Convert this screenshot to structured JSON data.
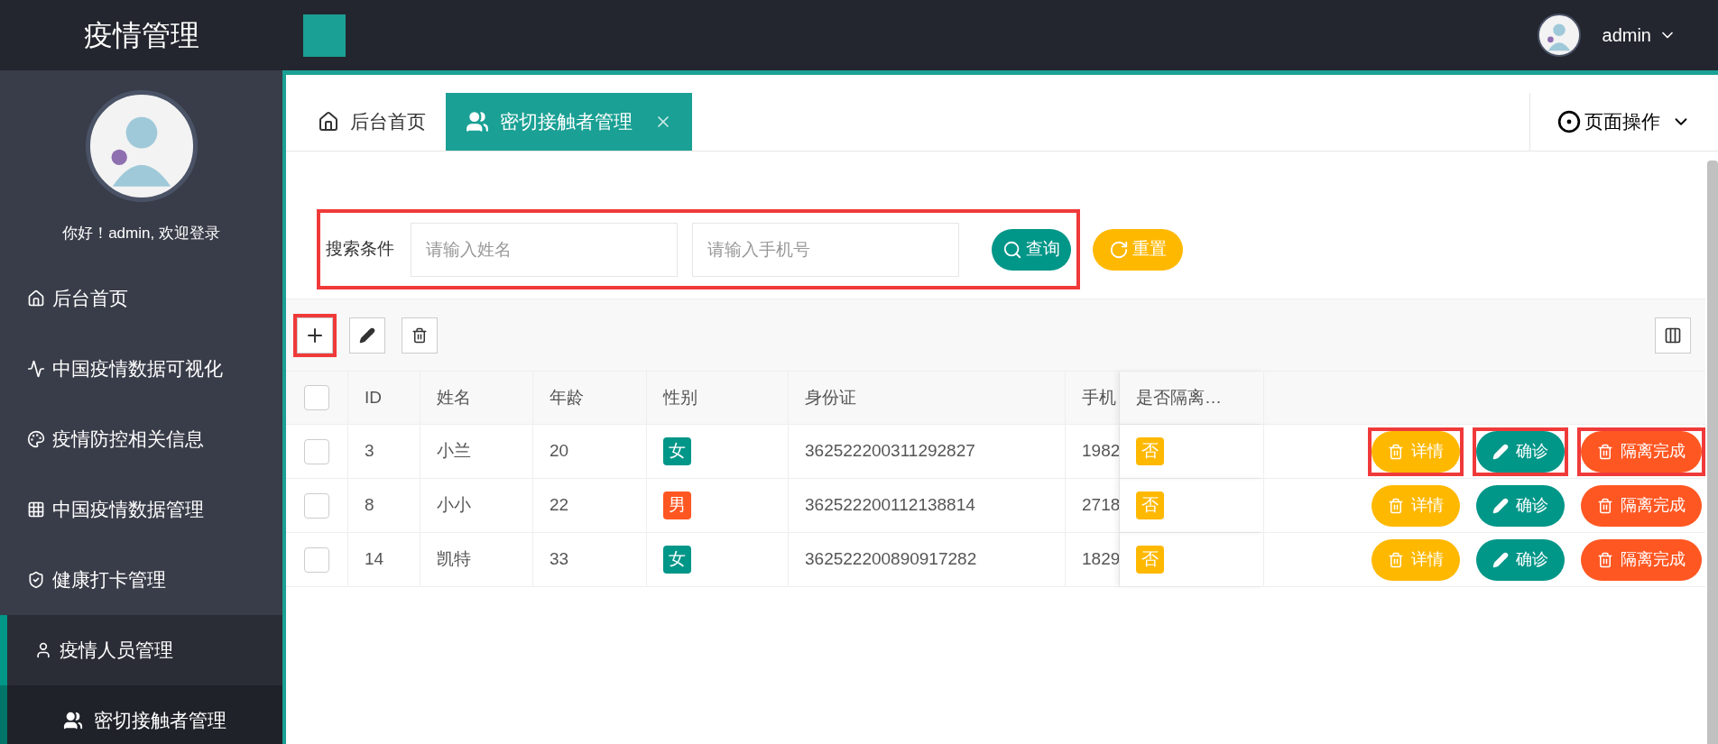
{
  "header": {
    "title": "疫情管理",
    "user": "admin"
  },
  "sidebar": {
    "greeting": "你好！admin, 欢迎登录",
    "items": [
      {
        "label": "后台首页",
        "selected": false
      },
      {
        "label": "中国疫情数据可视化",
        "selected": false
      },
      {
        "label": "疫情防控相关信息",
        "selected": false
      },
      {
        "label": "中国疫情数据管理",
        "selected": false
      },
      {
        "label": "健康打卡管理",
        "selected": false
      },
      {
        "label": "疫情人员管理",
        "selected": true,
        "children": [
          {
            "label": "密切接触者管理",
            "selected": true
          }
        ]
      }
    ]
  },
  "tabs": [
    {
      "label": "后台首页",
      "selected": false,
      "closable": false
    },
    {
      "label": "密切接触者管理",
      "selected": true,
      "closable": true
    }
  ],
  "page_actions": "页面操作",
  "search": {
    "label": "搜索条件",
    "highlighted": true,
    "fields": [
      {
        "placeholder": "请输入姓名"
      },
      {
        "placeholder": "请输入手机号"
      }
    ],
    "buttons": [
      {
        "label": "查询",
        "kind": "query"
      },
      {
        "label": "重置",
        "kind": "reset"
      }
    ]
  },
  "toolbar": [
    {
      "kind": "add",
      "highlighted": true
    },
    {
      "kind": "edit",
      "highlighted": false
    },
    {
      "kind": "delete",
      "highlighted": false
    }
  ],
  "table": {
    "all_checked": false,
    "columns": [
      "ID",
      "姓名",
      "年龄",
      "性别",
      "身份证",
      "手机",
      "是否隔离…"
    ],
    "rows": [
      {
        "checked": false,
        "id": "3",
        "name": "小兰",
        "age": "20",
        "sex": {
          "label": "女",
          "color": "#009688"
        },
        "idcard": "362522200311292827",
        "phone": "1982",
        "isolated": {
          "label": "否",
          "color": "#ffb800"
        },
        "actions": [
          {
            "label": "详情",
            "kind": "detail",
            "highlighted": true
          },
          {
            "label": "确诊",
            "kind": "confirm",
            "highlighted": true
          },
          {
            "label": "隔离完成",
            "kind": "finish",
            "highlighted": true
          }
        ]
      },
      {
        "checked": false,
        "id": "8",
        "name": "小小",
        "age": "22",
        "sex": {
          "label": "男",
          "color": "#ff5722"
        },
        "idcard": "362522200112138814",
        "phone": "2718",
        "isolated": {
          "label": "否",
          "color": "#ffb800"
        },
        "actions": [
          {
            "label": "详情",
            "kind": "detail",
            "highlighted": false
          },
          {
            "label": "确诊",
            "kind": "confirm",
            "highlighted": false
          },
          {
            "label": "隔离完成",
            "kind": "finish",
            "highlighted": false
          }
        ]
      },
      {
        "checked": false,
        "id": "14",
        "name": "凯特",
        "age": "33",
        "sex": {
          "label": "女",
          "color": "#009688"
        },
        "idcard": "362522200890917282",
        "phone": "1829",
        "isolated": {
          "label": "否",
          "color": "#ffb800"
        },
        "actions": [
          {
            "label": "详情",
            "kind": "detail",
            "highlighted": false
          },
          {
            "label": "确诊",
            "kind": "confirm",
            "highlighted": false
          },
          {
            "label": "隔离完成",
            "kind": "finish",
            "highlighted": false
          }
        ]
      }
    ]
  }
}
